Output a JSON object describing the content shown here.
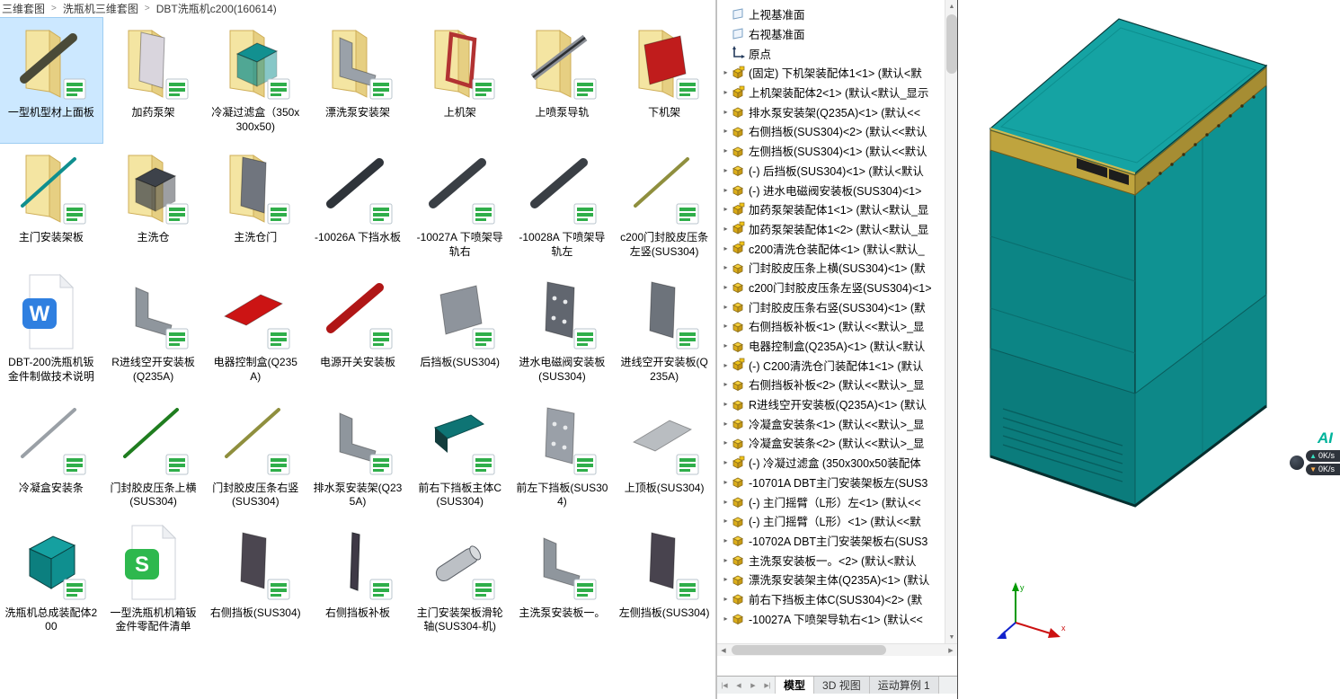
{
  "breadcrumb": {
    "separator": ">",
    "items": [
      "三维套图",
      "洗瓶机三维套图",
      "DBT洗瓶机c200(160614)"
    ]
  },
  "file_grid": {
    "items": [
      {
        "label": "一型机型材上面板",
        "icon": "part",
        "folder": true,
        "shape": "diag",
        "color": "#4a4a38",
        "selected": true
      },
      {
        "label": "加药泵架",
        "icon": "part",
        "folder": true,
        "shape": "door",
        "color": "#d9d5dd"
      },
      {
        "label": "冷凝过滤盒（350x300x50)",
        "icon": "part",
        "folder": true,
        "shape": "box",
        "color": "#129090"
      },
      {
        "label": "漂洗泵安装架",
        "icon": "part",
        "folder": true,
        "shape": "bracket",
        "color": "#9aa1a9"
      },
      {
        "label": "上机架",
        "icon": "part",
        "folder": true,
        "shape": "frame",
        "color": "#b23232"
      },
      {
        "label": "上喷泵导轨",
        "icon": "part",
        "folder": true,
        "shape": "rail",
        "color": "#8b8f96"
      },
      {
        "label": "下机架",
        "icon": "part",
        "folder": true,
        "shape": "panel",
        "color": "#c01c1c"
      },
      {
        "label": "主门安装架板",
        "icon": "part",
        "folder": true,
        "shape": "thin",
        "color": "#0f8f8f"
      },
      {
        "label": "主洗仓",
        "icon": "part",
        "folder": true,
        "shape": "box",
        "color": "#3d424a"
      },
      {
        "label": "主洗仓门",
        "icon": "part",
        "folder": true,
        "shape": "door",
        "color": "#70757e"
      },
      {
        "label": "-10026A 下挡水板",
        "icon": "part",
        "shape": "diag",
        "color": "#2f343a"
      },
      {
        "label": "-10027A 下喷架导轨右",
        "icon": "part",
        "shape": "diag",
        "color": "#3a3f45"
      },
      {
        "label": "-10028A 下喷架导轨左",
        "icon": "part",
        "shape": "diag",
        "color": "#3a3f45"
      },
      {
        "label": "c200门封胶皮压条左竖(SUS304)",
        "icon": "part",
        "shape": "thin",
        "color": "#8f8f3e"
      },
      {
        "label": "DBT-200洗瓶机钣金件制做技术说明",
        "icon": "word"
      },
      {
        "label": "R进线空开安装板(Q235A)",
        "icon": "part",
        "shape": "bracket",
        "color": "#8f969d"
      },
      {
        "label": "电器控制盒(Q235A)",
        "icon": "part",
        "shape": "plate",
        "color": "#cc1414"
      },
      {
        "label": "电源开关安装板",
        "icon": "part",
        "shape": "diag",
        "color": "#b01616"
      },
      {
        "label": "后挡板(SUS304)",
        "icon": "part",
        "shape": "panel",
        "color": "#8e949c"
      },
      {
        "label": "进水电磁阀安装板(SUS304)",
        "icon": "part",
        "shape": "holed",
        "color": "#61666f"
      },
      {
        "label": "进线空开安装板(Q235A)",
        "icon": "part",
        "shape": "door",
        "color": "#6d737b"
      },
      {
        "label": "冷凝盒安装条",
        "icon": "part",
        "shape": "thin",
        "color": "#9aa0a6"
      },
      {
        "label": "门封胶皮压条上横(SUS304)",
        "icon": "part",
        "shape": "thin",
        "color": "#1f7d1f"
      },
      {
        "label": "门封胶皮压条右竖(SUS304)",
        "icon": "part",
        "shape": "thin",
        "color": "#8f8f3e"
      },
      {
        "label": "排水泵安装架(Q235A)",
        "icon": "part",
        "shape": "bracket",
        "color": "#8f969d"
      },
      {
        "label": "前右下挡板主体C(SUS304)",
        "icon": "part",
        "shape": "wedge",
        "color": "#0e7474"
      },
      {
        "label": "前左下挡板(SUS304)",
        "icon": "part",
        "shape": "holed",
        "color": "#9aa0a8"
      },
      {
        "label": "上顶板(SUS304)",
        "icon": "part",
        "shape": "plate",
        "color": "#b9bdc1"
      },
      {
        "label": "洗瓶机总成装配体200",
        "icon": "assembly"
      },
      {
        "label": "一型洗瓶机机箱钣金件零配件清单",
        "icon": "excel"
      },
      {
        "label": "右侧挡板(SUS304)",
        "icon": "part",
        "shape": "door",
        "color": "#4b4650"
      },
      {
        "label": "右侧挡板补板",
        "icon": "part",
        "shape": "vbar",
        "color": "#3e3946"
      },
      {
        "label": "主门安装架板滑轮轴(SUS304-机)",
        "icon": "part",
        "shape": "cylinder",
        "color": "#bcc0c5"
      },
      {
        "label": "主洗泵安装板一。",
        "icon": "part",
        "shape": "bracket",
        "color": "#8f969d"
      },
      {
        "label": "左侧挡板(SUS304)",
        "icon": "part",
        "shape": "door",
        "color": "#48434e"
      }
    ]
  },
  "tree": {
    "items": [
      {
        "label": "上视基准面",
        "icon": "plane",
        "arrow": false
      },
      {
        "label": "右视基准面",
        "icon": "plane",
        "arrow": false
      },
      {
        "label": "原点",
        "icon": "origin",
        "arrow": false
      },
      {
        "label": "(固定) 下机架装配体1<1> (默认<默",
        "icon": "assembly",
        "arrow": true
      },
      {
        "label": "上机架装配体2<1> (默认<默认_显示",
        "icon": "assembly",
        "arrow": true
      },
      {
        "label": "排水泵安装架(Q235A)<1> (默认<<",
        "icon": "part",
        "arrow": true
      },
      {
        "label": "右侧挡板(SUS304)<2> (默认<<默认",
        "icon": "part",
        "arrow": true
      },
      {
        "label": "左侧挡板(SUS304)<1> (默认<<默认",
        "icon": "part",
        "arrow": true
      },
      {
        "label": "(-) 后挡板(SUS304)<1> (默认<默认",
        "icon": "part",
        "arrow": true
      },
      {
        "label": "(-) 进水电磁阀安装板(SUS304)<1>",
        "icon": "part",
        "arrow": true
      },
      {
        "label": "加药泵架装配体1<1> (默认<默认_显",
        "icon": "assembly",
        "arrow": true
      },
      {
        "label": "加药泵架装配体1<2> (默认<默认_显",
        "icon": "assembly",
        "arrow": true
      },
      {
        "label": "c200清洗仓装配体<1> (默认<默认_",
        "icon": "assembly",
        "arrow": true
      },
      {
        "label": "门封胶皮压条上横(SUS304)<1> (默",
        "icon": "part",
        "arrow": true
      },
      {
        "label": "c200门封胶皮压条左竖(SUS304)<1>",
        "icon": "part",
        "arrow": true
      },
      {
        "label": "门封胶皮压条右竖(SUS304)<1> (默",
        "icon": "part",
        "arrow": true
      },
      {
        "label": "右侧挡板补板<1> (默认<<默认>_显",
        "icon": "part",
        "arrow": true
      },
      {
        "label": "电器控制盒(Q235A)<1> (默认<默认",
        "icon": "part",
        "arrow": true
      },
      {
        "label": "(-) C200清洗仓门装配体1<1> (默认",
        "icon": "assembly",
        "arrow": true
      },
      {
        "label": "右侧挡板补板<2> (默认<<默认>_显",
        "icon": "part",
        "arrow": true
      },
      {
        "label": "R进线空开安装板(Q235A)<1> (默认",
        "icon": "part",
        "arrow": true
      },
      {
        "label": "冷凝盒安装条<1> (默认<<默认>_显",
        "icon": "part",
        "arrow": true
      },
      {
        "label": "冷凝盒安装条<2> (默认<<默认>_显",
        "icon": "part",
        "arrow": true
      },
      {
        "label": "(-) 冷凝过滤盒 (350x300x50装配体",
        "icon": "assembly",
        "arrow": true
      },
      {
        "label": "-10701A DBT主门安装架板左(SUS3",
        "icon": "part",
        "arrow": true
      },
      {
        "label": "(-) 主门摇臂（L形）左<1> (默认<<",
        "icon": "part",
        "arrow": true
      },
      {
        "label": "(-) 主门摇臂（L形）<1> (默认<<默",
        "icon": "part",
        "arrow": true
      },
      {
        "label": "-10702A DBT主门安装架板右(SUS3",
        "icon": "part",
        "arrow": true
      },
      {
        "label": "主洗泵安装板一。<2> (默认<默认",
        "icon": "part",
        "arrow": true
      },
      {
        "label": "漂洗泵安装架主体(Q235A)<1> (默认",
        "icon": "part",
        "arrow": true
      },
      {
        "label": "前右下挡板主体C(SUS304)<2> (默",
        "icon": "part",
        "arrow": true
      },
      {
        "label": "-10027A 下喷架导轨右<1> (默认<<",
        "icon": "part",
        "arrow": true
      }
    ]
  },
  "tabs": {
    "nav": [
      "|◀",
      "◀",
      "▶",
      "▶|"
    ],
    "items": [
      {
        "label": "模型",
        "active": true
      },
      {
        "label": "3D 视图",
        "active": false
      },
      {
        "label": "运动算例 1",
        "active": false
      }
    ]
  },
  "scrollbar": {
    "up": "▲",
    "down": "▼",
    "left": "◀",
    "right": "▶"
  },
  "overlay": {
    "ai": "AI",
    "up": "0K/s",
    "down": "0K/s"
  },
  "viewport": {
    "axis_x": "x",
    "axis_y": "y"
  },
  "colors": {
    "machine_top": "#15a3a3",
    "machine_front": "#0c8585",
    "machine_side": "#0f9292",
    "machine_band": "#bfa43e",
    "machine_band_side": "#a68d33",
    "machine_drawer": "#0b7c7c",
    "machine_side_lower": "#0d8888",
    "selection": "#cce8ff"
  }
}
